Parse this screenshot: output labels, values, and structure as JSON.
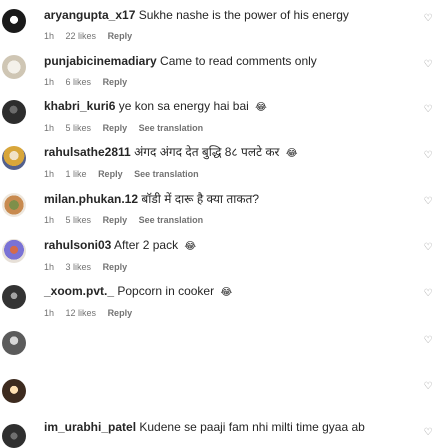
{
  "comments": [
    {
      "username": "aryangupta_x17",
      "text": "Sukhe nashe is the power of his energy",
      "time": "1h",
      "likes": "22 likes",
      "reply": "Reply",
      "translate": "",
      "emoji": ""
    },
    {
      "username": "punjabicinemadiary",
      "text": "Came to read comments only",
      "time": "1h",
      "likes": "6 likes",
      "reply": "Reply",
      "translate": "",
      "emoji": ""
    },
    {
      "username": "khabri_kuri6",
      "text": "ye kon sa energy hai bai",
      "time": "1h",
      "likes": "5 likes",
      "reply": "Reply",
      "translate": "See translation",
      "emoji": "😂"
    },
    {
      "username": "rahulsathe2811",
      "text": "अंगद अंगद देत बुद्धि 8८ पलटे कर",
      "time": "1h",
      "likes": "1 like",
      "reply": "Reply",
      "translate": "See translation",
      "emoji": "😂"
    },
    {
      "username": "milan.phukan.12",
      "text": "बॉडी में दारू है क्या ताकत?",
      "time": "1h",
      "likes": "5 likes",
      "reply": "Reply",
      "translate": "See translation",
      "emoji": ""
    },
    {
      "username": "rahulsoni03",
      "text": "After 2 pack",
      "time": "1h",
      "likes": "3 likes",
      "reply": "Reply",
      "translate": "",
      "emoji": "😂"
    },
    {
      "username": "_xoom.pvt._",
      "text": "Popcorn in cooker",
      "time": "1h",
      "likes": "12 likes",
      "reply": "Reply",
      "translate": "",
      "emoji": "😂"
    },
    {
      "username": "im_urabhi_patel",
      "text": "Kudene se paaji fam nhi milti time gyaa ab",
      "time": "",
      "likes": "",
      "reply": "",
      "translate": "",
      "emoji": ""
    }
  ],
  "icons": {
    "like": "heart-outline-icon"
  }
}
